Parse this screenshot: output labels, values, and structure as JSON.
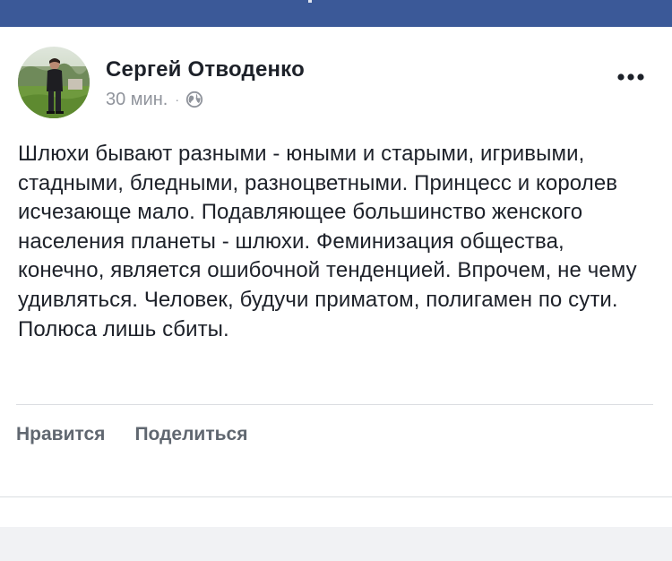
{
  "post": {
    "author": "Сергей Отводенко",
    "timestamp": "30 мин.",
    "separator": "·",
    "privacy_icon": "globe-icon",
    "more_icon": "more-dots-icon",
    "body": "Шлюхи бывают разными - юными и старыми, игривыми, стадными, бледными, разноцветными. Принцесс и королев исчезающе мало. Подавляющее большинство женского населения планеты - шлюхи. Феминизация общества, конечно, является ошибочной тенденцией. Впрочем, не чему удивляться. Человек, будучи приматом, полигамен по сути. Полюса лишь сбиты."
  },
  "actions": {
    "like_label": "Нравится",
    "share_label": "Поделиться"
  },
  "colors": {
    "top_bar": "#3b5998",
    "name": "#1d2129",
    "meta": "#90949c",
    "action": "#606770",
    "divider": "#dadde1",
    "feed_background": "#f1f2f4"
  }
}
